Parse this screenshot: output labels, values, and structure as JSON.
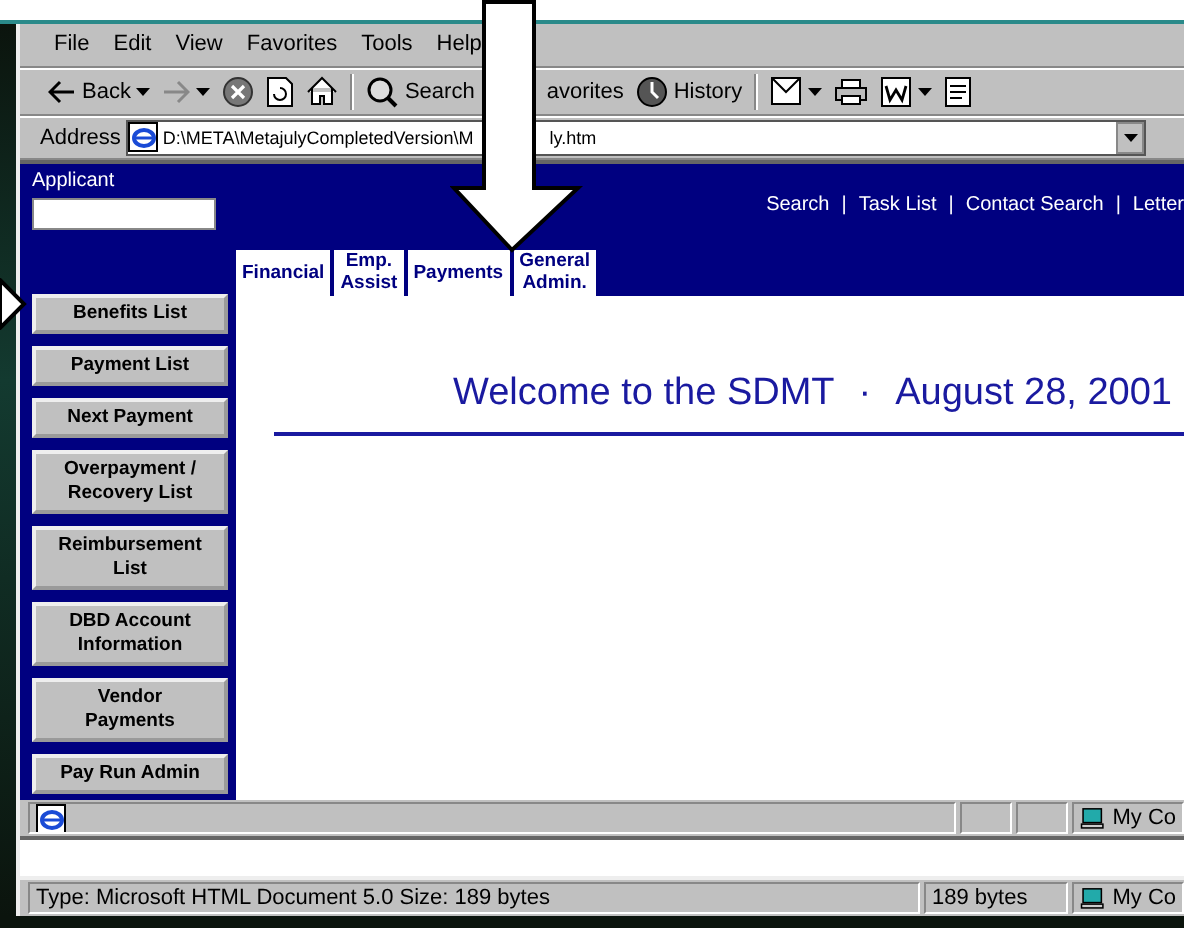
{
  "menu_bar": [
    "File",
    "Edit",
    "View",
    "Favorites",
    "Tools",
    "Help"
  ],
  "toolbar": [
    {
      "kind": "back",
      "label": "Back"
    },
    {
      "kind": "forward"
    },
    {
      "kind": "stop"
    },
    {
      "kind": "refresh"
    },
    {
      "kind": "home"
    },
    {
      "kind": "separator"
    },
    {
      "kind": "search",
      "label": "Search"
    },
    {
      "kind": "favorites",
      "label": "avorites"
    },
    {
      "kind": "history",
      "label": "History"
    },
    {
      "kind": "separator"
    },
    {
      "kind": "mail"
    },
    {
      "kind": "print"
    },
    {
      "kind": "edit"
    },
    {
      "kind": "discuss"
    }
  ],
  "address_bar": {
    "label": "Address",
    "value_before_arrow": "D:\\META\\MetajulyCompletedVersion\\M",
    "value_after_arrow": "ly.htm"
  },
  "applicant": {
    "label": "Applicant"
  },
  "header_links": [
    {
      "label": "Search",
      "separator": "|"
    },
    {
      "label": "Task List",
      "separator": "|"
    },
    {
      "label": "Contact Search",
      "separator": "|"
    },
    {
      "label": "Letter"
    }
  ],
  "tabs": [
    {
      "label": "Financial"
    },
    {
      "label": "Emp.\nAssist"
    },
    {
      "label": "Payments"
    },
    {
      "label": "General\nAdmin."
    }
  ],
  "sidebar_buttons": [
    "Benefits List",
    "Payment List",
    "Next Payment",
    "Overpayment /\nRecovery List",
    "Reimbursement\nList",
    "DBD Account\nInformation",
    "Vendor\nPayments",
    "Pay Run Admin"
  ],
  "welcome": {
    "title": "Welcome to the SDMT",
    "separator": "·",
    "date": "August 28, 2001"
  },
  "status_bar": {
    "zone": "My Co"
  },
  "details_bar": {
    "text": "Type: Microsoft HTML Document 5.0 Size: 189 bytes",
    "size": "189 bytes",
    "zone": "My Co"
  }
}
